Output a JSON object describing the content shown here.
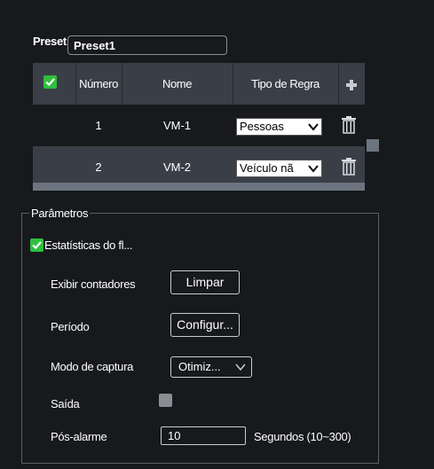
{
  "preset": {
    "label": "Preset",
    "value": "Preset1"
  },
  "table": {
    "headers": {
      "number": "Número",
      "name": "Nome",
      "rule_type": "Tipo de Regra"
    },
    "rows": [
      {
        "number": "1",
        "name": "VM-1",
        "rule_type": "Pessoas"
      },
      {
        "number": "2",
        "name": "VM-2",
        "rule_type": "Veículo nã"
      }
    ]
  },
  "params": {
    "legend": "Parâmetros",
    "stats_label": "Estatísticas do fl...",
    "show_counters_label": "Exibir contadores",
    "clear_button": "Limpar",
    "period_label": "Período",
    "config_button": "Configur...",
    "capture_mode_label": "Modo de captura",
    "capture_mode_value": "Otimiz...",
    "output_label": "Saída",
    "post_alarm_label": "Pós-alarme",
    "post_alarm_value": "10",
    "post_alarm_unit": "Segundos (10~300)"
  },
  "colors": {
    "accent_green": "#2fbf3e",
    "header_bg": "#3a3f47",
    "selected_row_bg": "#3a3f47"
  }
}
